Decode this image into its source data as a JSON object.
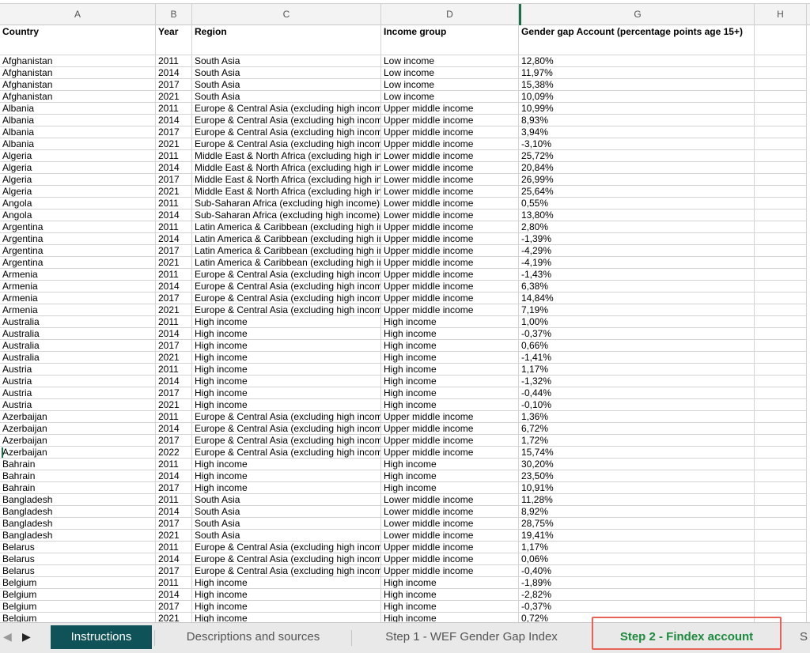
{
  "columns": [
    {
      "letter": "A"
    },
    {
      "letter": "B"
    },
    {
      "letter": "C"
    },
    {
      "letter": "D"
    },
    {
      "letter": "G"
    },
    {
      "letter": "H"
    }
  ],
  "header": {
    "country": "Country",
    "year": "Year",
    "region": "Region",
    "income": "Income group",
    "gap": "Gender gap Account  (percentage points age 15+)"
  },
  "rows": [
    [
      "Afghanistan",
      "2011",
      "South Asia",
      "Low income",
      "12,80%"
    ],
    [
      "Afghanistan",
      "2014",
      "South Asia",
      "Low income",
      "11,97%"
    ],
    [
      "Afghanistan",
      "2017",
      "South Asia",
      "Low income",
      "15,38%"
    ],
    [
      "Afghanistan",
      "2021",
      "South Asia",
      "Low income",
      "10,09%"
    ],
    [
      "Albania",
      "2011",
      "Europe & Central Asia (excluding high income)",
      "Upper middle income",
      "10,99%"
    ],
    [
      "Albania",
      "2014",
      "Europe & Central Asia (excluding high income)",
      "Upper middle income",
      "8,93%"
    ],
    [
      "Albania",
      "2017",
      "Europe & Central Asia (excluding high income)",
      "Upper middle income",
      "3,94%"
    ],
    [
      "Albania",
      "2021",
      "Europe & Central Asia (excluding high income)",
      "Upper middle income",
      "-3,10%"
    ],
    [
      "Algeria",
      "2011",
      "Middle East & North Africa (excluding high income)",
      "Lower middle income",
      "25,72%"
    ],
    [
      "Algeria",
      "2014",
      "Middle East & North Africa (excluding high income)",
      "Lower middle income",
      "20,84%"
    ],
    [
      "Algeria",
      "2017",
      "Middle East & North Africa (excluding high income)",
      "Lower middle income",
      "26,99%"
    ],
    [
      "Algeria",
      "2021",
      "Middle East & North Africa (excluding high income)",
      "Lower middle income",
      "25,64%"
    ],
    [
      "Angola",
      "2011",
      "Sub-Saharan Africa (excluding high income)",
      "Lower middle income",
      "0,55%"
    ],
    [
      "Angola",
      "2014",
      "Sub-Saharan Africa (excluding high income)",
      "Lower middle income",
      "13,80%"
    ],
    [
      "Argentina",
      "2011",
      "Latin America & Caribbean (excluding high income)",
      "Upper middle income",
      "2,80%"
    ],
    [
      "Argentina",
      "2014",
      "Latin America & Caribbean (excluding high income)",
      "Upper middle income",
      "-1,39%"
    ],
    [
      "Argentina",
      "2017",
      "Latin America & Caribbean (excluding high income)",
      "Upper middle income",
      "-4,29%"
    ],
    [
      "Argentina",
      "2021",
      "Latin America & Caribbean (excluding high income)",
      "Upper middle income",
      "-4,19%"
    ],
    [
      "Armenia",
      "2011",
      "Europe & Central Asia (excluding high income)",
      "Upper middle income",
      "-1,43%"
    ],
    [
      "Armenia",
      "2014",
      "Europe & Central Asia (excluding high income)",
      "Upper middle income",
      "6,38%"
    ],
    [
      "Armenia",
      "2017",
      "Europe & Central Asia (excluding high income)",
      "Upper middle income",
      "14,84%"
    ],
    [
      "Armenia",
      "2021",
      "Europe & Central Asia (excluding high income)",
      "Upper middle income",
      "7,19%"
    ],
    [
      "Australia",
      "2011",
      "High income",
      "High income",
      "1,00%"
    ],
    [
      "Australia",
      "2014",
      "High income",
      "High income",
      "-0,37%"
    ],
    [
      "Australia",
      "2017",
      "High income",
      "High income",
      "0,66%"
    ],
    [
      "Australia",
      "2021",
      "High income",
      "High income",
      "-1,41%"
    ],
    [
      "Austria",
      "2011",
      "High income",
      "High income",
      "1,17%"
    ],
    [
      "Austria",
      "2014",
      "High income",
      "High income",
      "-1,32%"
    ],
    [
      "Austria",
      "2017",
      "High income",
      "High income",
      "-0,44%"
    ],
    [
      "Austria",
      "2021",
      "High income",
      "High income",
      "-0,10%"
    ],
    [
      "Azerbaijan",
      "2011",
      "Europe & Central Asia (excluding high income)",
      "Upper middle income",
      "1,36%"
    ],
    [
      "Azerbaijan",
      "2014",
      "Europe & Central Asia (excluding high income)",
      "Upper middle income",
      "6,72%"
    ],
    [
      "Azerbaijan",
      "2017",
      "Europe & Central Asia (excluding high income)",
      "Upper middle income",
      "1,72%"
    ],
    [
      "Azerbaijan",
      "2022",
      "Europe & Central Asia (excluding high income)",
      "Upper middle income",
      "15,74%"
    ],
    [
      "Bahrain",
      "2011",
      "High income",
      "High income",
      "30,20%"
    ],
    [
      "Bahrain",
      "2014",
      "High income",
      "High income",
      "23,50%"
    ],
    [
      "Bahrain",
      "2017",
      "High income",
      "High income",
      "10,91%"
    ],
    [
      "Bangladesh",
      "2011",
      "South Asia",
      "Lower middle income",
      "11,28%"
    ],
    [
      "Bangladesh",
      "2014",
      "South Asia",
      "Lower middle income",
      "8,92%"
    ],
    [
      "Bangladesh",
      "2017",
      "South Asia",
      "Lower middle income",
      "28,75%"
    ],
    [
      "Bangladesh",
      "2021",
      "South Asia",
      "Lower middle income",
      "19,41%"
    ],
    [
      "Belarus",
      "2011",
      "Europe & Central Asia (excluding high income)",
      "Upper middle income",
      "1,17%"
    ],
    [
      "Belarus",
      "2014",
      "Europe & Central Asia (excluding high income)",
      "Upper middle income",
      "0,06%"
    ],
    [
      "Belarus",
      "2017",
      "Europe & Central Asia (excluding high income)",
      "Upper middle income",
      "-0,40%"
    ],
    [
      "Belgium",
      "2011",
      "High income",
      "High income",
      "-1,89%"
    ],
    [
      "Belgium",
      "2014",
      "High income",
      "High income",
      "-2,82%"
    ],
    [
      "Belgium",
      "2017",
      "High income",
      "High income",
      "-0,37%"
    ],
    [
      "Belgium",
      "2021",
      "High income",
      "High income",
      "0,72%"
    ]
  ],
  "tabs": {
    "instructions": "Instructions",
    "descriptions": "Descriptions and sources",
    "step1": "Step 1 - WEF Gender Gap Index",
    "step2": "Step 2 - Findex account",
    "step3": "S"
  },
  "colors": {
    "accent": "#0f5257",
    "active_tab_text": "#1b8a3c",
    "highlight_border": "#e8625a"
  }
}
